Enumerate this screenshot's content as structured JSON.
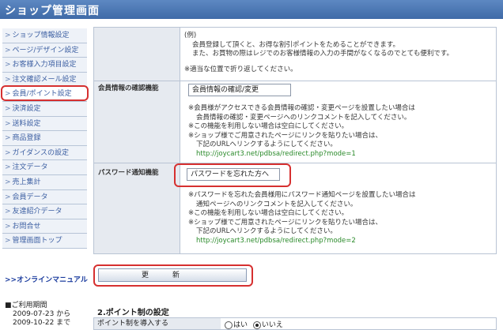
{
  "header": {
    "title": "ショップ管理画面"
  },
  "sidebar": {
    "items": [
      {
        "label": "ショップ情報設定"
      },
      {
        "label": "ページ/デザイン設定"
      },
      {
        "label": "お客様入力項目設定"
      },
      {
        "label": "注文確認メール設定"
      },
      {
        "label": "会員/ポイント設定"
      },
      {
        "label": "決済設定"
      },
      {
        "label": "送料設定"
      },
      {
        "label": "商品登録"
      },
      {
        "label": "ガイダンスの設定"
      },
      {
        "label": "注文データ"
      },
      {
        "label": "売上集計"
      },
      {
        "label": "会員データ"
      },
      {
        "label": "友達紹介データ"
      },
      {
        "label": "お問合せ"
      },
      {
        "label": "管理画面トップ"
      }
    ],
    "manual_link": ">>オンラインマニュアル",
    "period_title": "■ご利用期間",
    "period_start": "2009-07-23 から",
    "period_end": "2009-10-22 まで"
  },
  "example": {
    "lines": [
      "(例)",
      "会員登録して頂くと、お得な割引ポイントをためることができます。",
      "また、お買物の際はレジでのお客様情報の入力の手間がなくなるのでとても便利です。",
      "※適当な位置で折り返してください。"
    ]
  },
  "member_info": {
    "label": "会員情報の確認機能",
    "value": "会員情報の確認/変更",
    "notes": [
      "※会員様がアクセスできる会員情報の確認・変更ページを設置したい場合は",
      "会員情報の確認・変更ページへのリンクコメントを記入してください。",
      "※この機能を利用しない場合は空白にしてください。",
      "※ショップ様でご用意されたページにリンクを貼りたい場合は、",
      "下記のURLへリンクするようにしてください。",
      "http://joycart3.net/pdbsa/redirect.php?mode=1"
    ]
  },
  "password_notice": {
    "label": "パスワード通知機能",
    "value": "パスワードを忘れた方へ",
    "notes": [
      "※パスワードを忘れた会員様用にパスワード通知ページを設置したい場合は",
      "通知ページへのリンクコメントを記入してください。",
      "※この機能を利用しない場合は空白にしてください。",
      "※ショップ様でご用意されたページにリンクを貼りたい場合は、",
      "下記のURLへリンクするようにしてください。",
      "http://joycart3.net/pdbsa/redirect.php?mode=2"
    ]
  },
  "update_button": "更新",
  "section2": {
    "title": "2.ポイント制の設定",
    "row_label": "ポイント制を導入する",
    "yes": "はい",
    "no": "いいえ",
    "selected": "no"
  }
}
